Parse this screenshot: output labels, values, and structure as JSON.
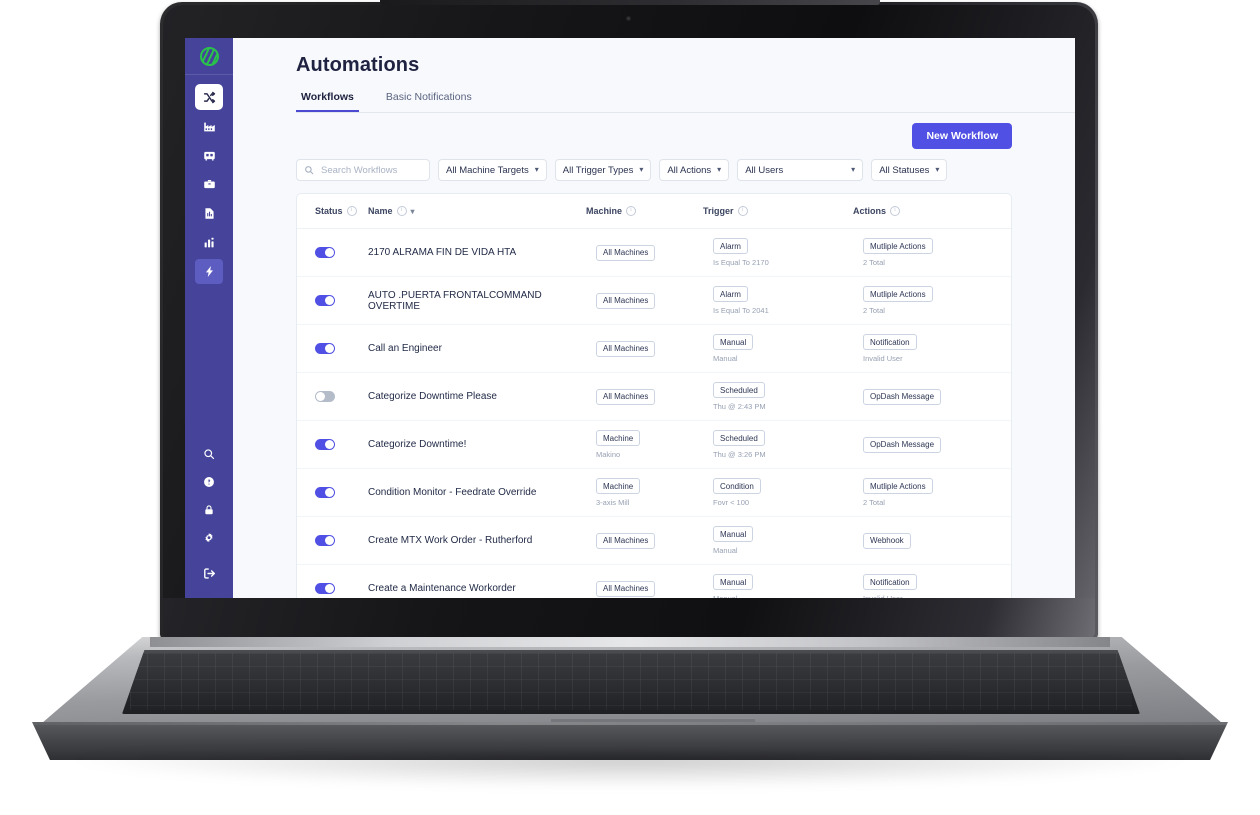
{
  "sidebar": {
    "brand": {
      "name": "app-logo",
      "color": "#29c24a"
    },
    "top_items": [
      {
        "icon": "shuffle-icon",
        "label": "Shuffle",
        "state": "active-white"
      },
      {
        "icon": "factory-icon",
        "label": "Factory",
        "state": "normal"
      },
      {
        "icon": "machine-icon",
        "label": "Machines",
        "state": "normal"
      },
      {
        "icon": "toolbox-icon",
        "label": "Toolbox",
        "state": "normal"
      },
      {
        "icon": "report-icon",
        "label": "Reports",
        "state": "normal"
      },
      {
        "icon": "analytics-bar-icon",
        "label": "Analytics",
        "state": "normal"
      },
      {
        "icon": "lightning-bolt-icon",
        "label": "Automations",
        "state": "active-light"
      }
    ],
    "bottom_items": [
      {
        "icon": "search-icon",
        "label": "Search"
      },
      {
        "icon": "help-circle-icon",
        "label": "Help"
      },
      {
        "icon": "lock-icon",
        "label": "Security"
      },
      {
        "icon": "gear-icon",
        "label": "Settings"
      }
    ],
    "logout": {
      "icon": "logout-icon",
      "label": "Log out"
    }
  },
  "header": {
    "title": "Automations",
    "tabs": [
      {
        "label": "Workflows",
        "selected": true
      },
      {
        "label": "Basic Notifications",
        "selected": false
      }
    ]
  },
  "toolbar": {
    "new_workflow_label": "New Workflow"
  },
  "filters": {
    "search": {
      "placeholder": "Search Workflows",
      "value": ""
    },
    "selects": [
      {
        "name": "machine-targets",
        "label": "All Machine Targets",
        "wide": false
      },
      {
        "name": "trigger-types",
        "label": "All Trigger Types",
        "wide": false
      },
      {
        "name": "actions",
        "label": "All Actions",
        "wide": false
      },
      {
        "name": "users",
        "label": "All Users",
        "wide": true
      },
      {
        "name": "statuses",
        "label": "All Statuses",
        "wide": false
      }
    ]
  },
  "table": {
    "columns": [
      {
        "key": "status",
        "label": "Status",
        "info": true,
        "sortable": false
      },
      {
        "key": "name",
        "label": "Name",
        "info": true,
        "sortable": true
      },
      {
        "key": "machine",
        "label": "Machine",
        "info": true,
        "sortable": false
      },
      {
        "key": "trigger",
        "label": "Trigger",
        "info": true,
        "sortable": false
      },
      {
        "key": "actions",
        "label": "Actions",
        "info": true,
        "sortable": false
      }
    ],
    "rows": [
      {
        "enabled": true,
        "name": "2170 ALRAMA FIN DE VIDA HTA",
        "machine_chip": "All Machines",
        "machine_sub": "",
        "trigger_chip": "Alarm",
        "trigger_sub": "Is Equal To 2170",
        "action_chip": "Mutliple Actions",
        "action_sub": "2 Total"
      },
      {
        "enabled": true,
        "name": "AUTO .PUERTA FRONTALCOMMAND OVERTIME",
        "machine_chip": "All Machines",
        "machine_sub": "",
        "trigger_chip": "Alarm",
        "trigger_sub": "Is Equal To 2041",
        "action_chip": "Mutliple Actions",
        "action_sub": "2 Total"
      },
      {
        "enabled": true,
        "name": "Call an Engineer",
        "machine_chip": "All Machines",
        "machine_sub": "",
        "trigger_chip": "Manual",
        "trigger_sub": "Manual",
        "action_chip": "Notification",
        "action_sub": "Invalid User"
      },
      {
        "enabled": false,
        "name": "Categorize Downtime Please",
        "machine_chip": "All Machines",
        "machine_sub": "",
        "trigger_chip": "Scheduled",
        "trigger_sub": "Thu @ 2:43 PM",
        "action_chip": "OpDash Message",
        "action_sub": ""
      },
      {
        "enabled": true,
        "name": "Categorize Downtime!",
        "machine_chip": "Machine",
        "machine_sub": "Makino",
        "trigger_chip": "Scheduled",
        "trigger_sub": "Thu @ 3:26 PM",
        "action_chip": "OpDash Message",
        "action_sub": ""
      },
      {
        "enabled": true,
        "name": "Condition Monitor - Feedrate Override",
        "machine_chip": "Machine",
        "machine_sub": "3-axis Mill",
        "trigger_chip": "Condition",
        "trigger_sub": "Fovr < 100",
        "action_chip": "Mutliple Actions",
        "action_sub": "2 Total"
      },
      {
        "enabled": true,
        "name": "Create MTX Work Order - Rutherford",
        "machine_chip": "All Machines",
        "machine_sub": "",
        "trigger_chip": "Manual",
        "trigger_sub": "Manual",
        "action_chip": "Webhook",
        "action_sub": ""
      },
      {
        "enabled": true,
        "name": "Create a Maintenance Workorder",
        "machine_chip": "All Machines",
        "machine_sub": "",
        "trigger_chip": "Manual",
        "trigger_sub": "Manual",
        "action_chip": "Notification",
        "action_sub": "Invalid User"
      }
    ]
  },
  "theme": {
    "sidebar_bg": "#45449a",
    "accent": "#5150e4",
    "page_bg": "#f7f9fc",
    "brand_green": "#29c24a"
  }
}
